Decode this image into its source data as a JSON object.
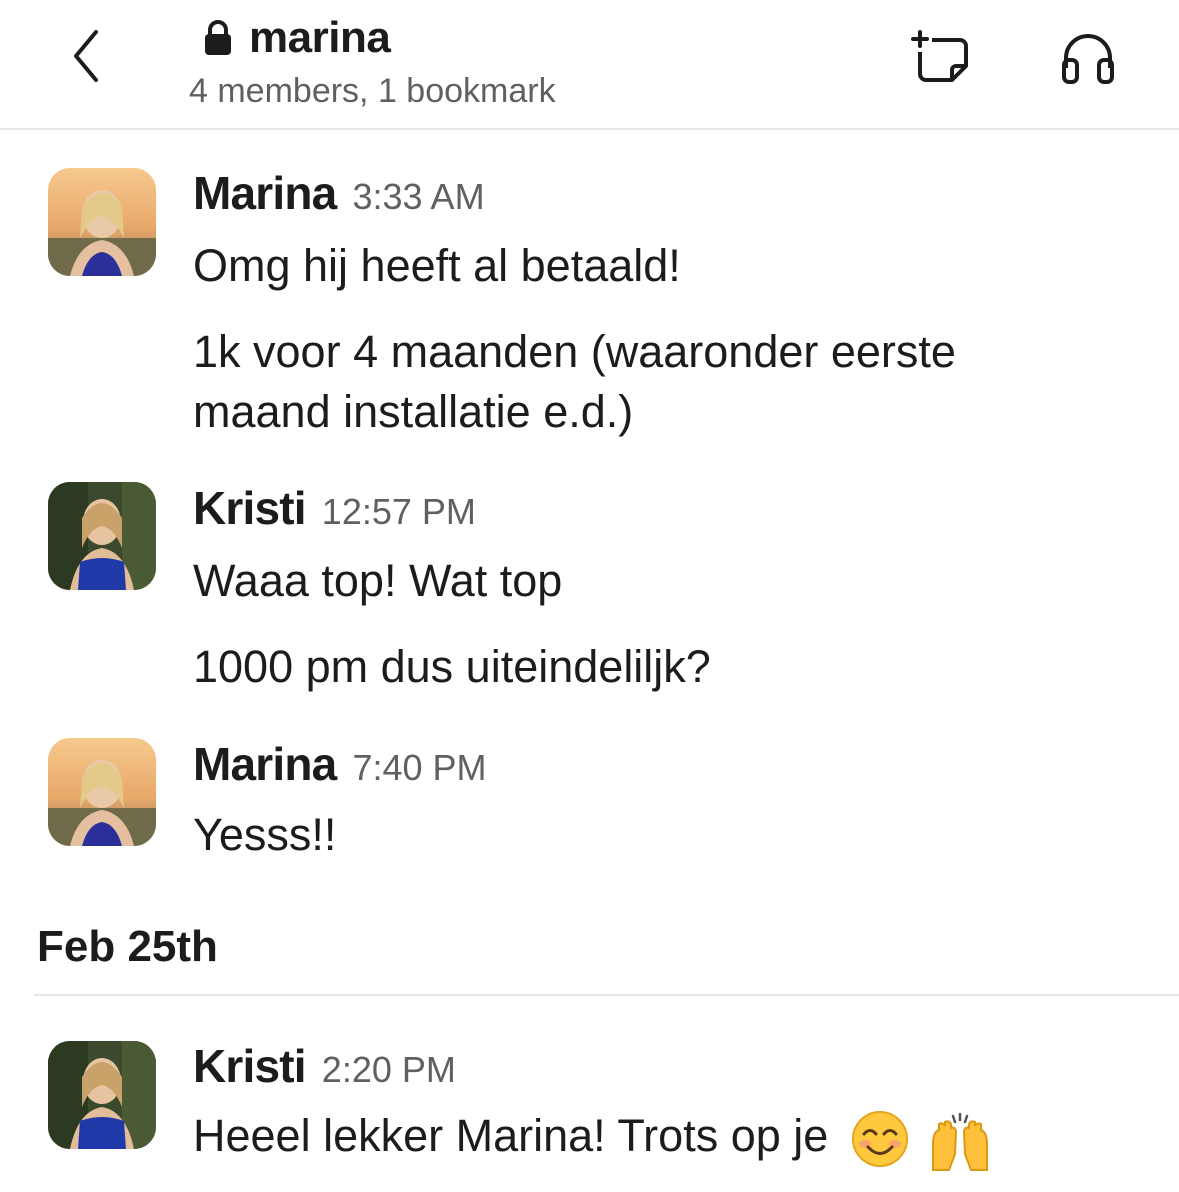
{
  "header": {
    "channel_name": "marina",
    "subtitle": "4 members, 1 bookmark",
    "icons": {
      "back": "chevron-left-icon",
      "lock": "lock-icon",
      "canvas": "add-canvas-icon",
      "huddle": "headphones-icon"
    }
  },
  "messages": [
    {
      "author": "Marina",
      "time": "3:33 AM",
      "lines": [
        "Omg hij heeft al betaald!",
        "1k voor 4 maanden (waaronder eerste",
        "maand installatie e.d.)"
      ]
    },
    {
      "author": "Kristi",
      "time": "12:57 PM",
      "lines": [
        "Waaa top! Wat top",
        "1000 pm dus uiteindelilјk?"
      ]
    },
    {
      "author": "Marina",
      "time": "7:40 PM",
      "lines": [
        "Yesss!!"
      ]
    },
    {
      "author": "Kristi",
      "time": "2:20 PM",
      "lines": [
        "Heeel lekker Marina! Trots op je"
      ],
      "emojis": [
        "smiling-face-icon",
        "raising-hands-icon"
      ]
    }
  ],
  "date_separator": "Feb 25th",
  "colors": {
    "text": "#1d1c1d",
    "secondary": "#616061",
    "divider": "#e6e6e6"
  }
}
